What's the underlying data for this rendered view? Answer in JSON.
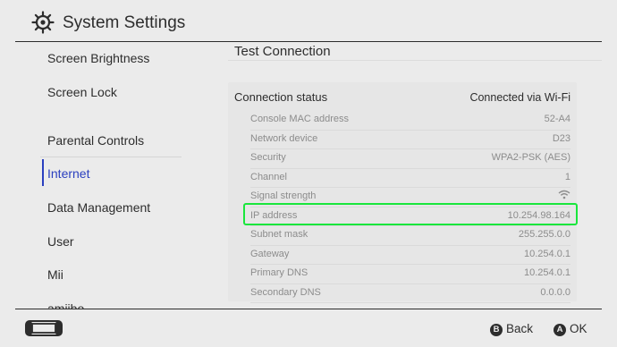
{
  "header": {
    "title": "System Settings",
    "icon": "gear-icon"
  },
  "sidebar": {
    "items": [
      {
        "label": "Screen Brightness"
      },
      {
        "label": "Screen Lock"
      },
      {
        "label": "Parental Controls"
      },
      {
        "label": "Internet"
      },
      {
        "label": "Data Management"
      },
      {
        "label": "User"
      },
      {
        "label": "Mii"
      },
      {
        "label": "amiibo"
      }
    ],
    "active": "Internet"
  },
  "main": {
    "title": "Test Connection",
    "status": {
      "label": "Connection status",
      "value": "Connected via Wi-Fi"
    },
    "rows": [
      {
        "label": "Console MAC address",
        "value": "52-A4"
      },
      {
        "label": "Network device",
        "value": "D23"
      },
      {
        "label": "Security",
        "value": "WPA2-PSK (AES)"
      },
      {
        "label": "Channel",
        "value": "1"
      },
      {
        "label": "Signal strength",
        "icon": "wifi-signal-icon"
      },
      {
        "label": "IP address",
        "value": "10.254.98.164"
      },
      {
        "label": "Subnet mask",
        "value": "255.255.0.0"
      },
      {
        "label": "Gateway",
        "value": "10.254.0.1"
      },
      {
        "label": "Primary DNS",
        "value": "10.254.0.1"
      },
      {
        "label": "Secondary DNS",
        "value": "0.0.0.0"
      }
    ],
    "highlight_color": "#19e63c"
  },
  "footer": {
    "back": {
      "glyph": "B",
      "label": "Back"
    },
    "ok": {
      "glyph": "A",
      "label": "OK"
    }
  },
  "colors": {
    "accent": "#2a3fbf",
    "background": "#ebebeb",
    "text": "#2d2d2d"
  }
}
